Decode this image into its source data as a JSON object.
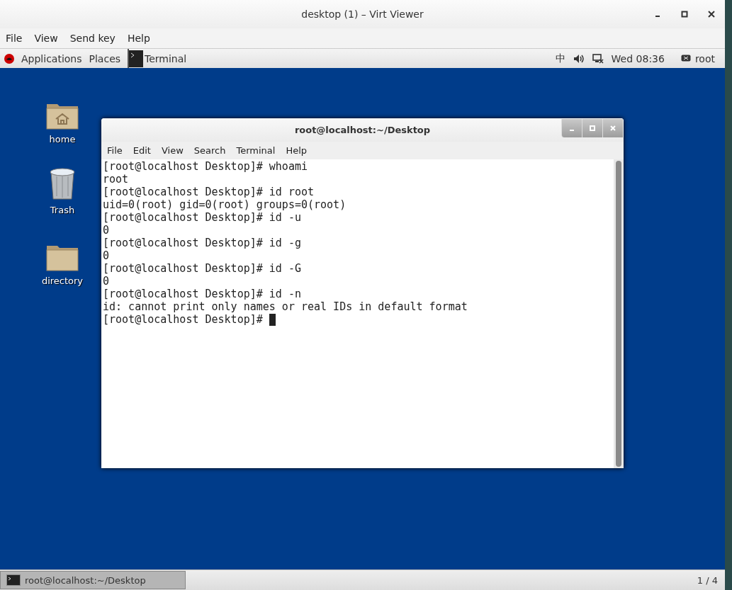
{
  "window": {
    "title": "desktop (1) – Virt Viewer"
  },
  "menu": [
    "File",
    "View",
    "Send key",
    "Help"
  ],
  "top_bar": {
    "applications": "Applications",
    "places": "Places",
    "task": "Terminal",
    "input_method": "中",
    "clock": "Wed 08:36",
    "user": "root"
  },
  "desktop_icons": [
    {
      "kind": "home",
      "label": "home"
    },
    {
      "kind": "trash",
      "label": "Trash"
    },
    {
      "kind": "folder",
      "label": "directory"
    }
  ],
  "terminal": {
    "title": "root@localhost:~/Desktop",
    "menu": [
      "File",
      "Edit",
      "View",
      "Search",
      "Terminal",
      "Help"
    ],
    "lines": [
      "[root@localhost Desktop]# whoami",
      "root",
      "[root@localhost Desktop]# id root",
      "uid=0(root) gid=0(root) groups=0(root)",
      "[root@localhost Desktop]# id -u",
      "0",
      "[root@localhost Desktop]# id -g",
      "0",
      "[root@localhost Desktop]# id -G",
      "0",
      "[root@localhost Desktop]# id -n",
      "id: cannot print only names or real IDs in default format",
      "[root@localhost Desktop]# "
    ],
    "cursor": true
  },
  "taskbar": {
    "task": "root@localhost:~/Desktop",
    "workspace": "1 / 4"
  }
}
